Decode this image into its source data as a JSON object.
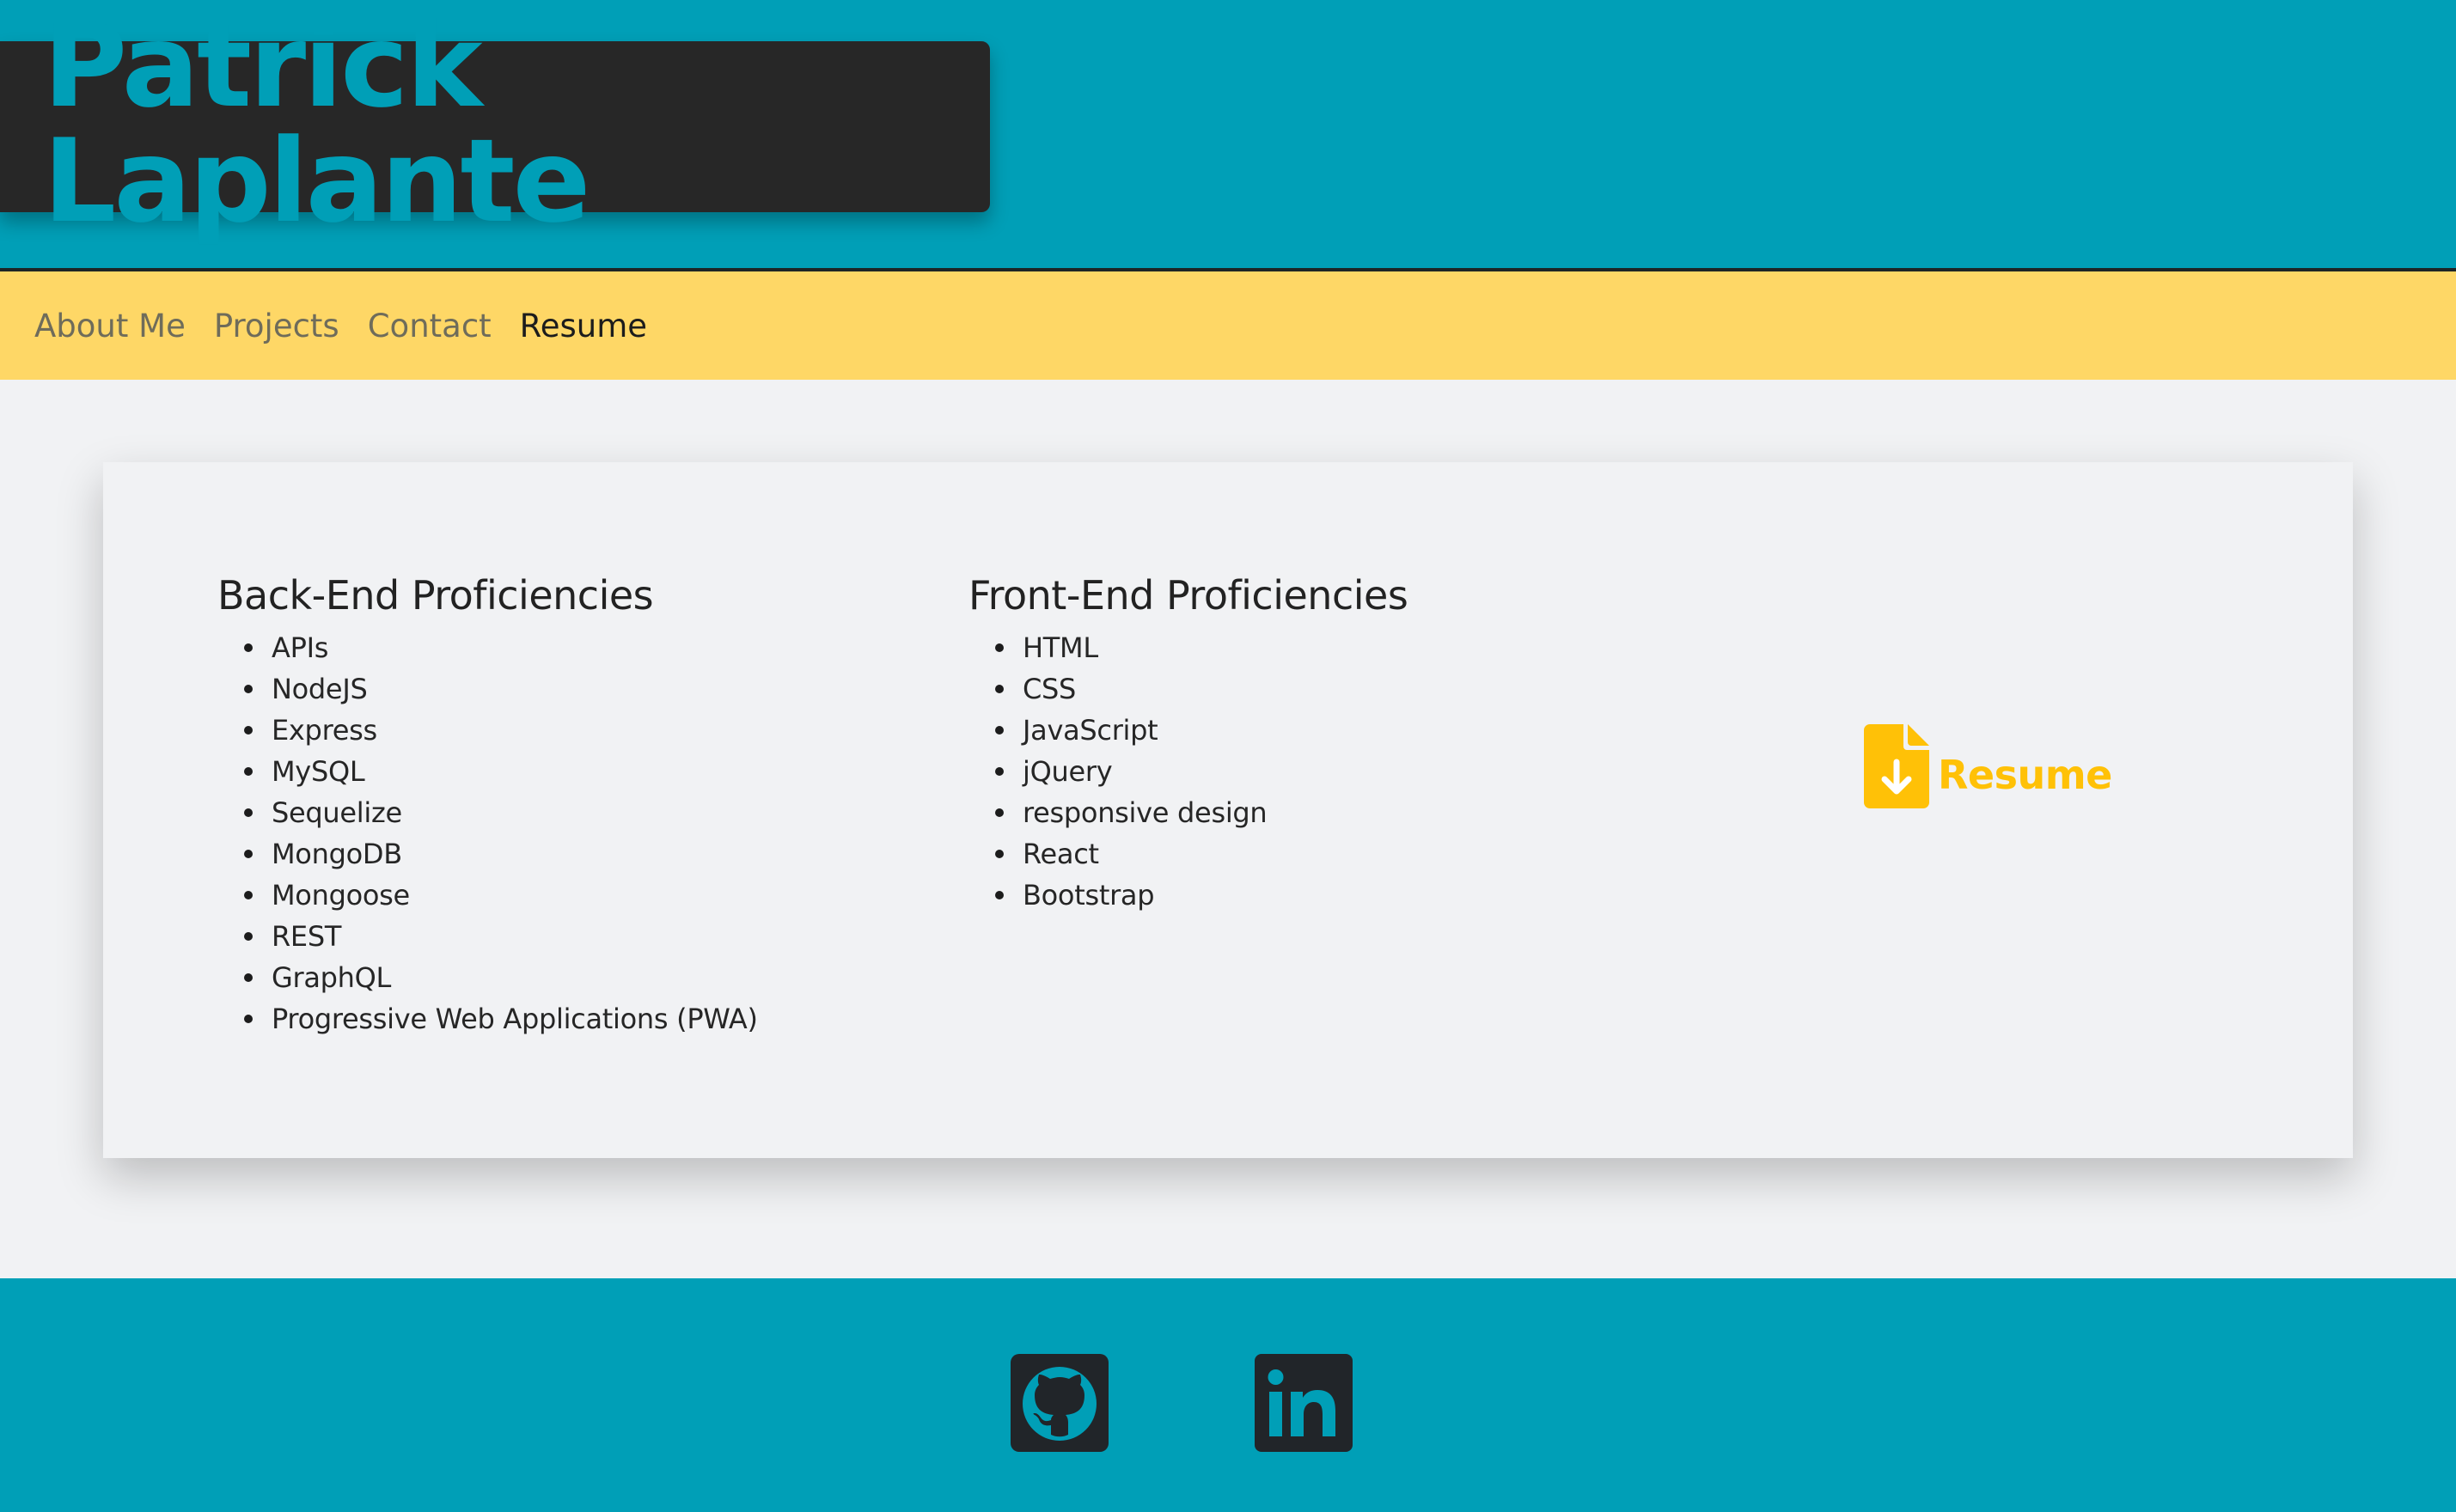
{
  "header": {
    "title": "Patrick Laplante"
  },
  "nav": {
    "items": [
      {
        "label": "About Me",
        "active": false
      },
      {
        "label": "Projects",
        "active": false
      },
      {
        "label": "Contact",
        "active": false
      },
      {
        "label": "Resume",
        "active": true
      }
    ]
  },
  "resume_section": {
    "backend": {
      "heading": "Back-End Proficiencies",
      "items": [
        "APIs",
        "NodeJS",
        "Express",
        "MySQL",
        "Sequelize",
        "MongoDB",
        "Mongoose",
        "REST",
        "GraphQL",
        "Progressive Web Applications (PWA)"
      ]
    },
    "frontend": {
      "heading": "Front-End Proficiencies",
      "items": [
        "HTML",
        "CSS",
        "JavaScript",
        "jQuery",
        "responsive design",
        "React",
        "Bootstrap"
      ]
    },
    "download": {
      "label": "Resume",
      "icon": "file-download-icon"
    }
  },
  "footer": {
    "links": [
      {
        "name": "github",
        "icon": "github-icon"
      },
      {
        "name": "linkedin",
        "icon": "linkedin-icon"
      }
    ]
  },
  "colors": {
    "primary": "#009fb7",
    "nav_bg": "#fed766",
    "title_bg": "#272727",
    "accent": "#ffc107",
    "page_bg": "#f1f2f4"
  }
}
